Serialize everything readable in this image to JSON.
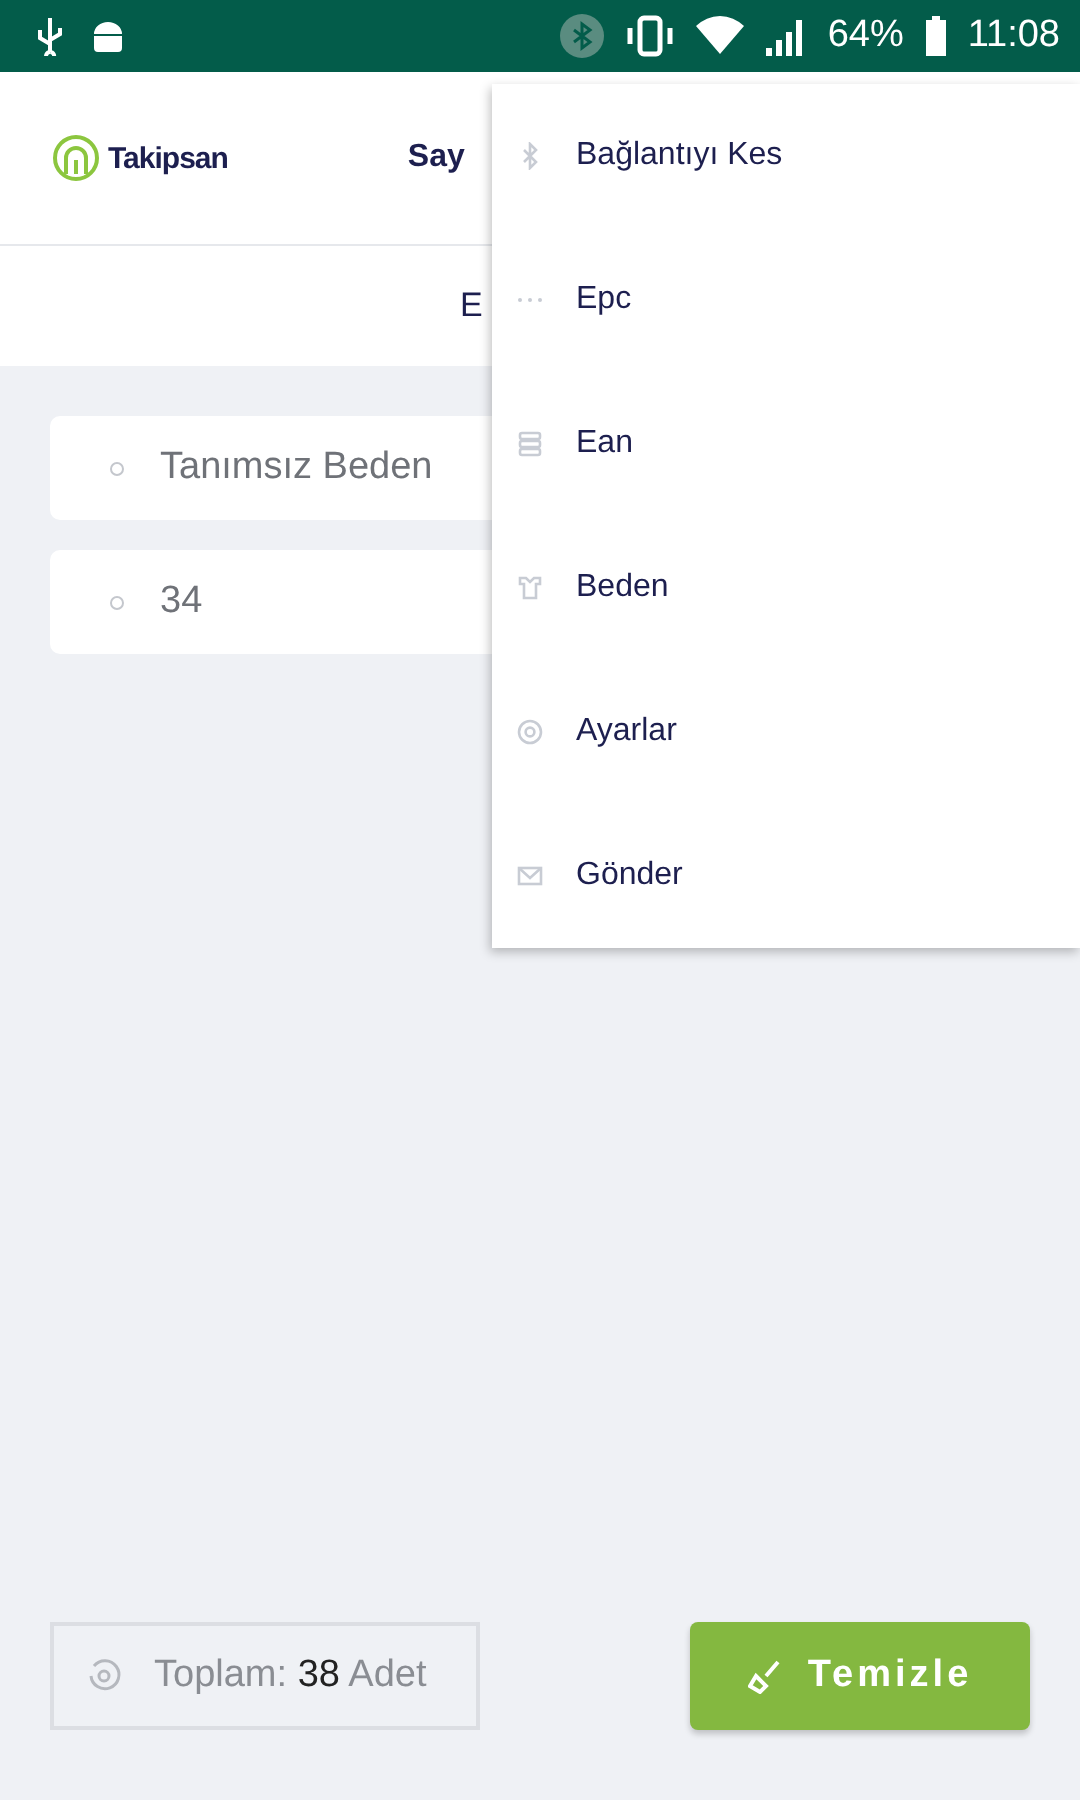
{
  "status_bar": {
    "battery": "64%",
    "time": "11:08"
  },
  "header": {
    "logo": "Takipsan",
    "title": "Say"
  },
  "subheader": {
    "title": "E"
  },
  "items": [
    {
      "label": "Tanımsız Beden"
    },
    {
      "label": "34"
    }
  ],
  "footer": {
    "total": "Toplam: **38** Adet",
    "button": "Temizle"
  },
  "menu": [
    {
      "kind": "bluetooth",
      "label": "Bağlantıyı Kes"
    },
    {
      "kind": "dots",
      "label": "Epc"
    },
    {
      "kind": "barcode",
      "label": "Ean"
    },
    {
      "kind": "shirt",
      "label": "Beden"
    },
    {
      "kind": "gear",
      "label": "Ayarlar"
    },
    {
      "kind": "mail",
      "label": "Gönder"
    }
  ]
}
